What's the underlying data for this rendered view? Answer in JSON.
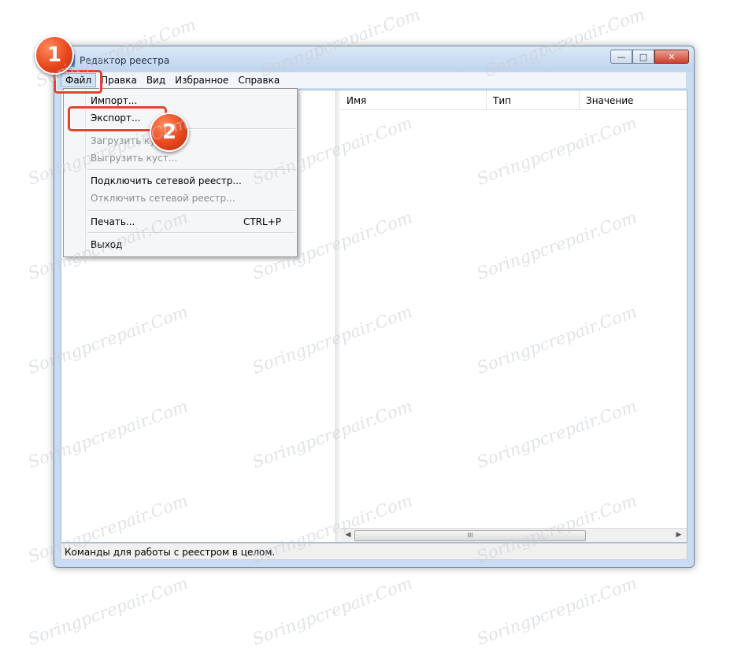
{
  "window": {
    "title": "Редактор реестра",
    "controls": {
      "minimize": "—",
      "maximize": "□",
      "close": "✕"
    }
  },
  "menubar": {
    "items": [
      "Файл",
      "Правка",
      "Вид",
      "Избранное",
      "Справка"
    ]
  },
  "file_menu": {
    "import": "Импорт...",
    "export": "Экспорт...",
    "load_hive": "Загрузить куст...",
    "unload_hive": "Выгрузить куст...",
    "connect_network": "Подключить сетевой реестр...",
    "disconnect_network": "Отключить сетевой реестр...",
    "print": "Печать...",
    "print_shortcut": "CTRL+P",
    "exit": "Выход"
  },
  "list": {
    "columns": [
      "Имя",
      "Тип",
      "Значение"
    ],
    "scroll_grip": "III"
  },
  "status": {
    "text": "Команды для работы с реестром в целом."
  },
  "callouts": {
    "one": "1",
    "two": "2"
  },
  "watermark": "Soringpcrepair.Com"
}
